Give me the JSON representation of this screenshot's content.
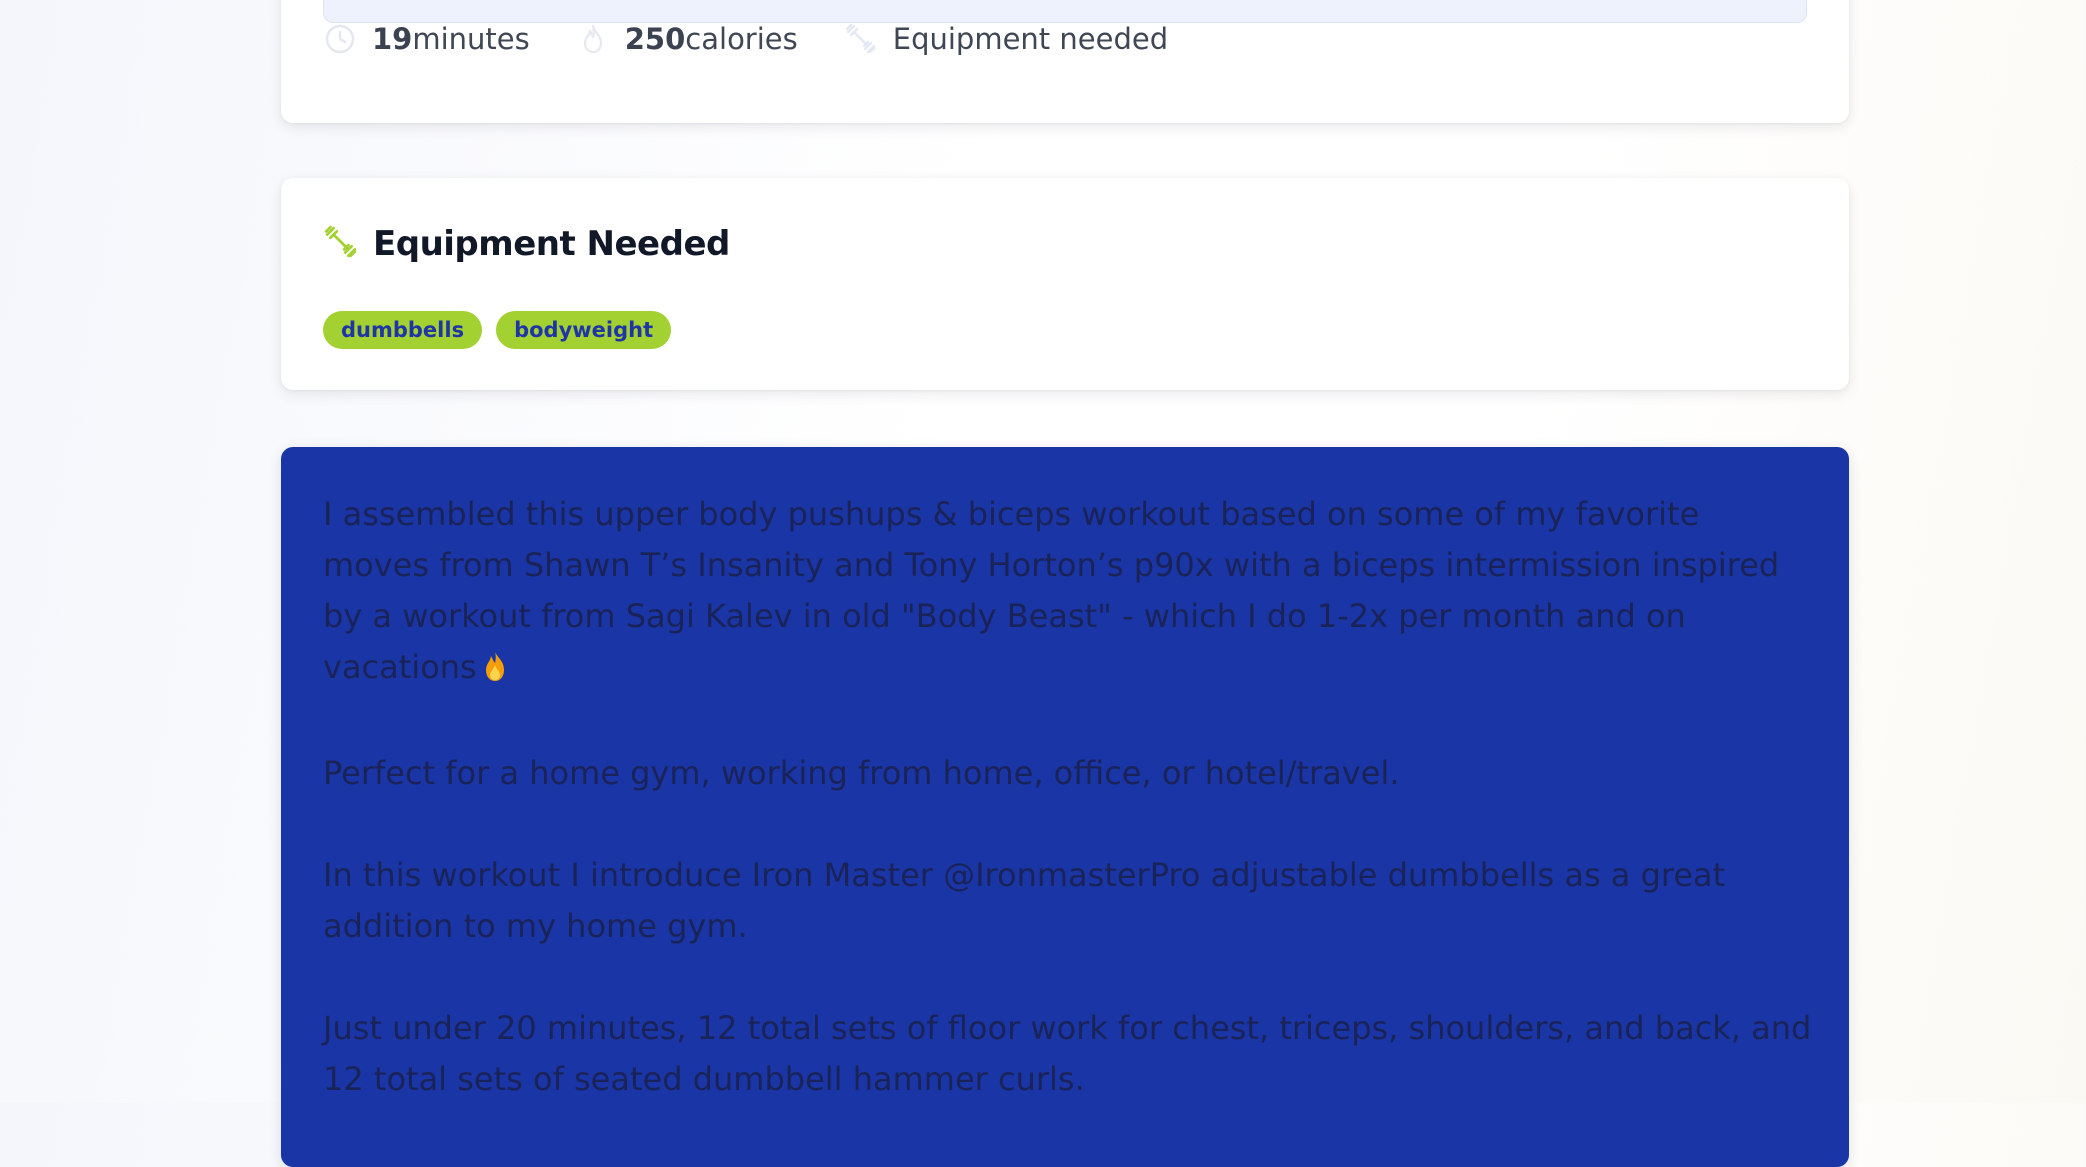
{
  "stats": {
    "duration_value": "19",
    "duration_unit": "minutes",
    "calories_value": "250",
    "calories_unit": "calories",
    "equipment_label": "Equipment needed"
  },
  "equipment": {
    "title": "Equipment Needed",
    "tags": [
      "dumbbells",
      "bodyweight"
    ]
  },
  "description": {
    "paragraphs": [
      "I assembled this upper body pushups & biceps workout based on some of my favorite moves from Shawn T’s Insanity and Tony Horton’s p90x with a biceps intermission inspired by a workout from Sagi Kalev in old \"Body Beast\" - which I do 1-2x per month and on vacations",
      "Perfect for a home gym, working from home, office, or hotel/travel.",
      "In this workout I introduce Iron Master @IronmasterPro adjustable dumbbells as a great addition to my home gym.",
      "Just under 20 minutes, 12 total sets of floor work for chest, triceps, shoulders, and back, and 12 total sets of seated dumbbell hammer curls."
    ]
  },
  "colors": {
    "accent_green": "#a3d131",
    "accent_blue": "#1a35a5",
    "tag_text": "#1f35a6"
  },
  "icons": {
    "duration": "clock-icon",
    "calories": "flame-icon",
    "equipment": "dumbbell-icon",
    "inline_emoji": "fire-emoji-icon"
  }
}
